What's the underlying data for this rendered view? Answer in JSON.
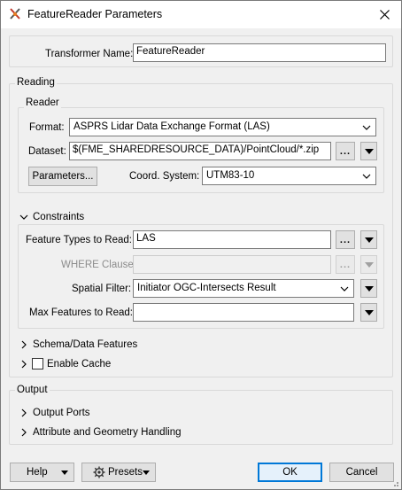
{
  "window": {
    "title": "FeatureReader Parameters"
  },
  "transformer_name": {
    "label": "Transformer Name:",
    "value": "FeatureReader"
  },
  "reading": {
    "title": "Reading",
    "reader": {
      "title": "Reader",
      "format_label": "Format:",
      "format_value": "ASPRS Lidar Data Exchange Format (LAS)",
      "dataset_label": "Dataset:",
      "dataset_value": "$(FME_SHAREDRESOURCE_DATA)/PointCloud/*.zip",
      "browse_label": "...",
      "parameters_button": "Parameters...",
      "coord_label": "Coord. System:",
      "coord_value": "UTM83-10"
    },
    "constraints": {
      "title": "Constraints",
      "feature_types_label": "Feature Types to Read:",
      "feature_types_value": "LAS",
      "where_label": "WHERE Clause:",
      "where_value": "",
      "spatial_label": "Spatial Filter:",
      "spatial_value": "Initiator OGC-Intersects Result",
      "max_features_label": "Max Features to Read:",
      "max_features_value": ""
    },
    "schema_label": "Schema/Data Features",
    "enable_cache_label": "Enable Cache"
  },
  "output": {
    "title": "Output",
    "ports_label": "Output Ports",
    "attr_label": "Attribute and Geometry Handling"
  },
  "footer": {
    "help": "Help",
    "presets": "Presets",
    "ok": "OK",
    "cancel": "Cancel"
  }
}
